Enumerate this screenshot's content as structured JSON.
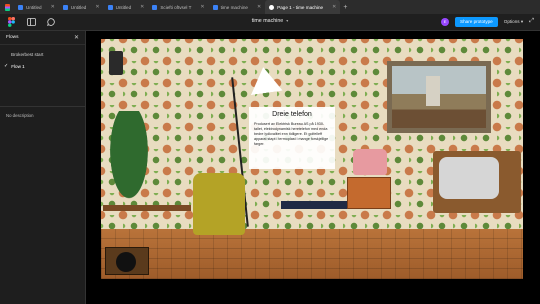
{
  "tabs": [
    {
      "label": "Untitled"
    },
    {
      "label": "Untitled"
    },
    {
      "label": "Untitled"
    },
    {
      "label": "Sciefti oftvsel T"
    },
    {
      "label": "time machine"
    },
    {
      "label": "Page 1 - time machine"
    }
  ],
  "toolbar": {
    "file_title": "time machine",
    "avatar_initial": "E",
    "share_label": "Share prototype",
    "options_label": "Options"
  },
  "sidebar": {
    "title": "Flows",
    "items": [
      {
        "label": "Brokerbest start"
      },
      {
        "label": "Flow 1"
      }
    ],
    "description": "No description"
  },
  "prototype": {
    "heading": "Dreie telefon",
    "body": "Produsert av Elektrisk Bureau AS på 1930-tallet, elektrodynamisk heretelefon med enda bedre lydkvalitet enn tidligere. Et golfelleff apparat stapt i termoplast i mange forskjellige farger."
  },
  "colors": {
    "accent": "#0d99ff",
    "avatar": "#9747ff"
  }
}
